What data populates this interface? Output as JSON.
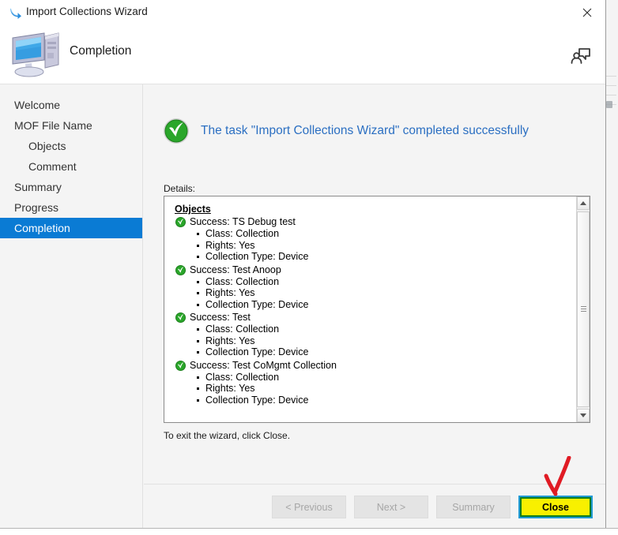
{
  "window": {
    "title": "Import Collections Wizard",
    "title_icon": "blue-curved-arrow-icon",
    "close_icon": "close-icon"
  },
  "header": {
    "page_title": "Completion",
    "icon": "computer-monitor-icon",
    "feedback_icon": "feedback-person-icon"
  },
  "sidebar": {
    "items": [
      {
        "label": "Welcome",
        "indent": false,
        "selected": false
      },
      {
        "label": "MOF File Name",
        "indent": false,
        "selected": false
      },
      {
        "label": "Objects",
        "indent": true,
        "selected": false
      },
      {
        "label": "Comment",
        "indent": true,
        "selected": false
      },
      {
        "label": "Summary",
        "indent": false,
        "selected": false
      },
      {
        "label": "Progress",
        "indent": false,
        "selected": false
      },
      {
        "label": "Completion",
        "indent": false,
        "selected": true
      }
    ],
    "selected_color": "#0a7bd4"
  },
  "content": {
    "success_message": "The task \"Import Collections Wizard\" completed successfully",
    "success_icon": "green-check-circle-icon",
    "success_text_color": "#2b6fc2",
    "details_label": "Details:",
    "details_heading": "Objects",
    "objects": [
      {
        "status_icon": "green-check-icon",
        "title": "Success: TS Debug test",
        "bullets": [
          "Class: Collection",
          "Rights: Yes",
          "Collection Type: Device"
        ]
      },
      {
        "status_icon": "green-check-icon",
        "title": "Success: Test Anoop",
        "bullets": [
          "Class: Collection",
          "Rights: Yes",
          "Collection Type: Device"
        ]
      },
      {
        "status_icon": "green-check-icon",
        "title": "Success: Test",
        "bullets": [
          "Class: Collection",
          "Rights: Yes",
          "Collection Type: Device"
        ]
      },
      {
        "status_icon": "green-check-icon",
        "title": "Success: Test CoMgmt Collection",
        "bullets": [
          "Class: Collection",
          "Rights: Yes",
          "Collection Type: Device"
        ]
      }
    ],
    "exit_note": "To exit the wizard, click Close."
  },
  "footer": {
    "previous_label": "< Previous",
    "next_label": "Next >",
    "summary_label": "Summary",
    "close_label": "Close",
    "close_highlight_color": "#f8f000"
  },
  "annotation": {
    "arrow_icon": "red-arrow-pointing-down",
    "arrow_color": "#e01b24"
  }
}
